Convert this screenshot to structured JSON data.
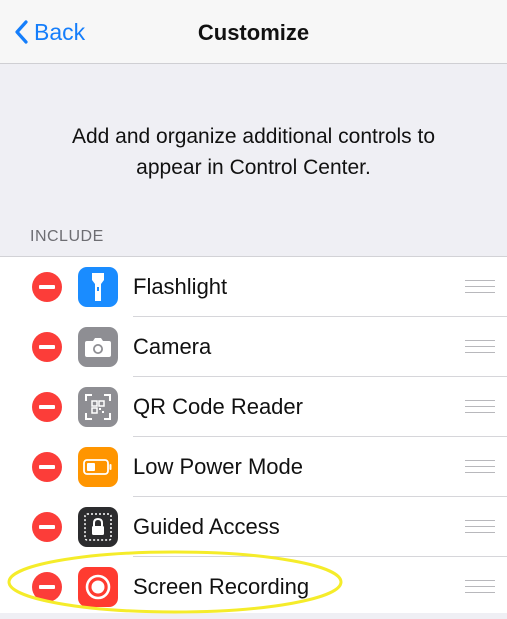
{
  "nav": {
    "back_label": "Back",
    "title": "Customize"
  },
  "intro": "Add and organize additional controls to appear in Control Center.",
  "section": {
    "header": "INCLUDE"
  },
  "items": [
    {
      "label": "Flashlight",
      "icon": "flashlight-icon",
      "color": "#1a8cff"
    },
    {
      "label": "Camera",
      "icon": "camera-icon",
      "color": "#8e8e93"
    },
    {
      "label": "QR Code Reader",
      "icon": "qr-code-icon",
      "color": "#8e8e93"
    },
    {
      "label": "Low Power Mode",
      "icon": "battery-icon",
      "color": "#ff9500"
    },
    {
      "label": "Guided Access",
      "icon": "lock-icon",
      "color": "#2c2c2e"
    },
    {
      "label": "Screen Recording",
      "icon": "record-icon",
      "color": "#ff3b30"
    }
  ],
  "colors": {
    "accent": "#157efb",
    "delete": "#fc3d39",
    "highlight": "#f5ec2a"
  }
}
